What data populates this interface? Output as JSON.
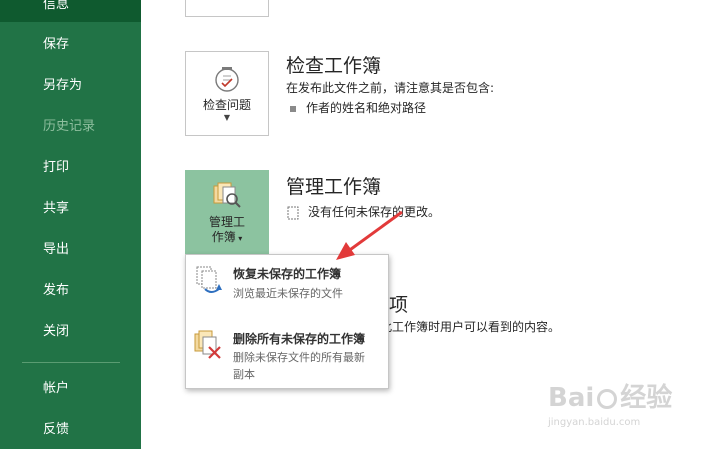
{
  "sidebar": {
    "items": [
      {
        "label": "信息",
        "state": "selected"
      },
      {
        "label": "保存",
        "state": "normal"
      },
      {
        "label": "另存为",
        "state": "normal"
      },
      {
        "label": "历史记录",
        "state": "disabled"
      },
      {
        "label": "打印",
        "state": "normal"
      },
      {
        "label": "共享",
        "state": "normal"
      },
      {
        "label": "导出",
        "state": "normal"
      },
      {
        "label": "发布",
        "state": "normal"
      },
      {
        "label": "关闭",
        "state": "normal"
      },
      {
        "label": "帐户",
        "state": "normal"
      },
      {
        "label": "反馈",
        "state": "normal"
      }
    ]
  },
  "inspect": {
    "button_label": "检查问题",
    "title": "检查工作簿",
    "desc": "在发布此文件之前，请注意其是否包含:",
    "bullet": "作者的姓名和绝对路径"
  },
  "manage": {
    "button_label_line1": "管理工",
    "button_label_line2": "作簿",
    "title": "管理工作簿",
    "status": "没有任何未保存的更改。"
  },
  "hidden_section": {
    "title_fragment": "选项",
    "desc_fragment": "此工作簿时用户可以看到的内容。"
  },
  "dropdown": {
    "items": [
      {
        "title": "恢复未保存的工作簿",
        "subtitle": "浏览最近未保存的文件"
      },
      {
        "title": "删除所有未保存的工作簿",
        "subtitle": "删除未保存文件的所有最新副本"
      }
    ]
  },
  "watermark": {
    "brand": "Bai",
    "brand_tail": "经验",
    "url": "jingyan.baidu.com"
  },
  "colors": {
    "sidebar": "#217346",
    "sidebar_selected": "#0f5a2f",
    "manage_tile": "#8cc3a0",
    "arrow": "#e23a3a"
  }
}
